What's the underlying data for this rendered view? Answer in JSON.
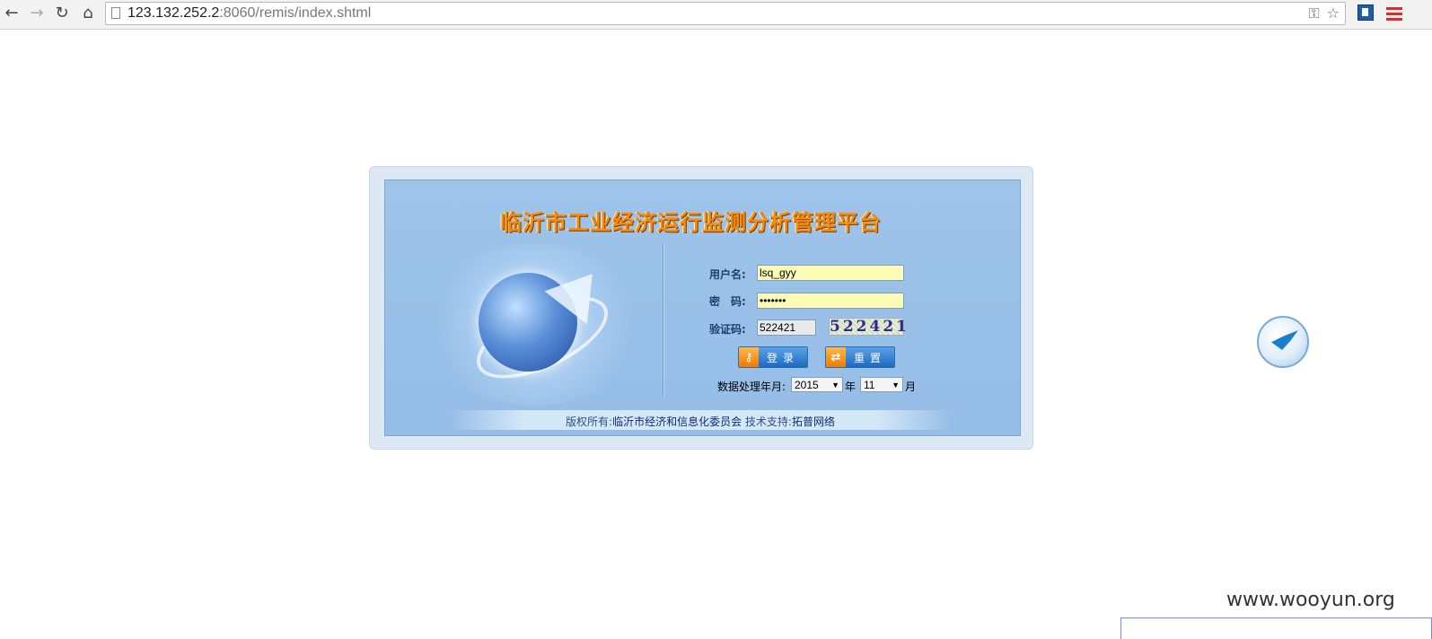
{
  "browser": {
    "url_host": "123.132.252.2",
    "url_rest": ":8060/remis/index.shtml"
  },
  "login": {
    "title": "临沂市工业经济运行监测分析管理平台",
    "username_label": "用户名:",
    "username_value": "lsq_gyy",
    "password_label": "密　码:",
    "password_value": "•••••••",
    "captcha_label": "验证码:",
    "captcha_value": "522421",
    "captcha_image_text": "522421",
    "login_button": "登录",
    "reset_button": "重置",
    "period_label": "数据处理年月:",
    "year_value": "2015",
    "year_suffix": "年",
    "month_value": "11",
    "month_suffix": "月"
  },
  "footer": {
    "copyright_label": "版权所有:",
    "copyright_value": "临沂市经济和信息化委员会",
    "support_label": "技术支持:",
    "support_value": "拓普网络"
  },
  "watermark": "www.wooyun.org",
  "icons": {
    "back": "arrow-left-icon",
    "forward": "arrow-right-icon",
    "reload": "reload-icon",
    "home": "home-icon",
    "key": "key-icon",
    "star": "star-icon",
    "menu": "menu-icon",
    "bird": "bird-float-icon"
  }
}
